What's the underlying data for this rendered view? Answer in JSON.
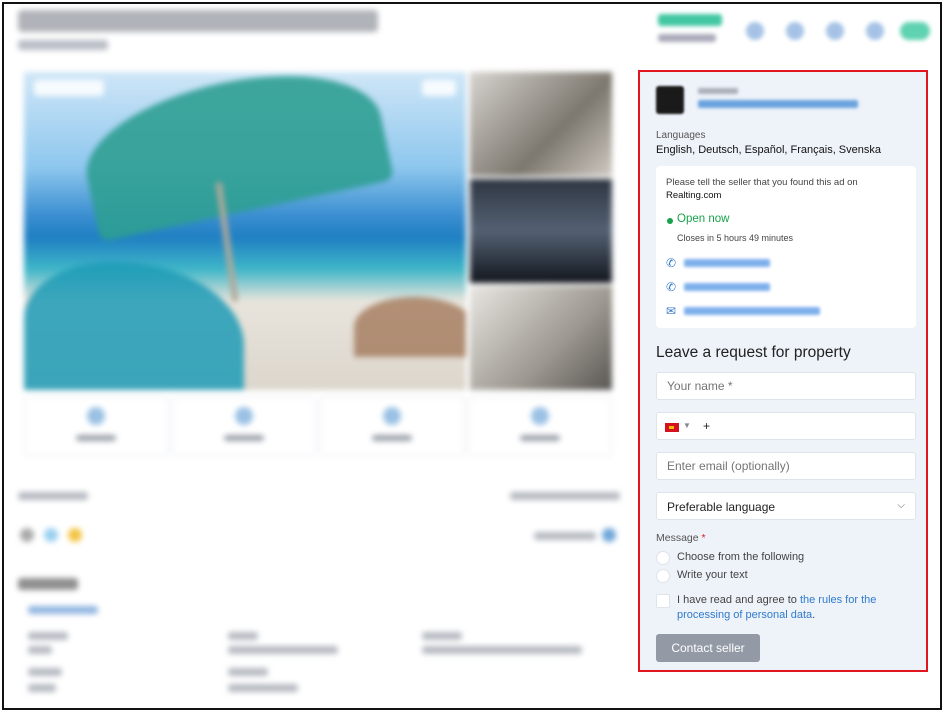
{
  "panel": {
    "languages_label": "Languages",
    "languages_value": "English, Deutsch, Español, Français, Svenska",
    "seller_card": {
      "tell_text": "Please tell the seller that you found this ad on",
      "site": "Realting.com",
      "status": "Open now",
      "closes": "Closes in 5 hours 49 minutes",
      "status_color": "#18a24b"
    },
    "request": {
      "title": "Leave a request for property",
      "name_placeholder": "Your name *",
      "phone_prefix": "+",
      "email_placeholder": "Enter email (optionally)",
      "language_select": "Preferable language",
      "message_label": "Message",
      "message_required": "*",
      "options": [
        "Choose from the following",
        "Write your text"
      ],
      "agree_text": "I have read and agree to",
      "agree_link": "the rules for the processing of personal data",
      "agree_end": ".",
      "submit": "Contact seller"
    }
  },
  "colors": {
    "highlight_border": "#e0171f",
    "link": "#2f7bcc",
    "button": "#939aa6",
    "panel_bg": "#eef2f9"
  },
  "icons": [
    "phone-icon",
    "phone-icon",
    "mail-icon",
    "chevron-down-icon",
    "spain-flag-icon"
  ]
}
